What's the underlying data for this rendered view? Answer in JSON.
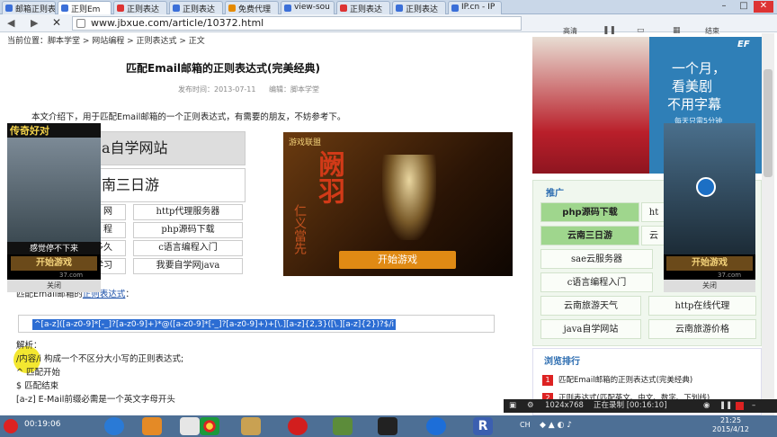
{
  "browser": {
    "tabs": [
      {
        "label": "邮箱正则表达"
      },
      {
        "label": "正则Em"
      },
      {
        "label": "正则表达"
      },
      {
        "label": "正则表达"
      },
      {
        "label": "免费代理"
      },
      {
        "label": "view-sou"
      },
      {
        "label": "正则表达"
      },
      {
        "label": "正则表达"
      },
      {
        "label": "IP.cn - IP"
      }
    ],
    "url": "www.jbxue.com/article/10372.html",
    "right_tools": [
      "高清",
      "结束"
    ]
  },
  "page": {
    "breadcrumb": "当前位置：脚本学堂 > 网站编程 > 正则表达式 > 正文",
    "title": "匹配Email邮箱的正则表达式(完美经典)",
    "meta_date": "发布时间：2013-07-11",
    "meta_editor": "编辑：脚本学堂",
    "intro": "本文介绍下，用于匹配Email邮箱的一个正则表达式，有需要的朋友，不妨参考下。",
    "box_ja": "a自学网站",
    "box_yn": "南三日游",
    "grid_left": [
      "网",
      "程",
      "多久",
      "学习"
    ],
    "grid_right": [
      "http代理服务器",
      "php源码下载",
      "c语言编程入门",
      "我要自学网java"
    ],
    "regex_prefix": "匹配Email邮箱的",
    "regex_link": "正则表达式",
    "regex": "^[a-z]([a-z0-9]*[-_]?[a-z0-9]+)*@([a-z0-9]*[-_]?[a-z0-9]+)+[\\.][a-z]{2,3}([\\.][a-z]{2})?$/i",
    "analysis": [
      "解析：",
      "/内容/i  构成一个不区分大小写的正则表达式;",
      "^  匹配开始",
      "$  匹配结束",
      "[a-z]   E-Mail前缀必需是一个英文字母开头"
    ]
  },
  "game_overlay_left": {
    "title": "传奇好对",
    "caption": "感觉停不下来",
    "button": "开始游戏",
    "site": "37.com",
    "close": "关闭"
  },
  "game_ad": {
    "brand": "游戏联盟",
    "big_text": "阙羽",
    "side_text": "仁义當先",
    "button": "开始游戏"
  },
  "sidebar": {
    "ef_badge": "EF",
    "ef_line1": "一个月，",
    "ef_line2": "看美剧",
    "ef_line3": "不用字幕",
    "ef_small": "每天只需5分钟",
    "tuiguang_label": "推广",
    "tuiguang_items": [
      {
        "label": "php源码下载",
        "style": "green"
      },
      {
        "label": "ht",
        "style": "plain"
      },
      {
        "label": "云南三日游",
        "style": "green"
      },
      {
        "label": "云",
        "style": "plain"
      },
      {
        "label": "sae云服务器",
        "style": "plain"
      },
      {
        "label": "c语言编程入门",
        "style": "plain"
      },
      {
        "label": "云南旅游天气",
        "style": "plain"
      },
      {
        "label": "http在线代理",
        "style": "plain"
      },
      {
        "label": "java自学网站",
        "style": "plain"
      },
      {
        "label": "云南旅游价格",
        "style": "plain"
      }
    ],
    "rank_title": "浏览排行",
    "rank_items": [
      {
        "num": "1",
        "label": "匹配Email邮箱的正则表达式(完美经典)"
      },
      {
        "num": "2",
        "label": "正则表达式(匹配英文、中文、数字、下划线)"
      }
    ]
  },
  "game_overlay_right": {
    "button": "开始游戏",
    "site": "37.com",
    "close": "关闭"
  },
  "recorder": {
    "resolution": "1024x768",
    "status": "正在录制 [00:16:10]"
  },
  "taskbar": {
    "recording_time": "00:19:06",
    "lang": "CH",
    "time": "21:25",
    "date": "2015/4/12"
  },
  "colors": {
    "taskbar": "#4d6f95",
    "green_item": "#9fd68d",
    "regex_select": "#2c6dd3",
    "link": "#1a4fa8"
  }
}
